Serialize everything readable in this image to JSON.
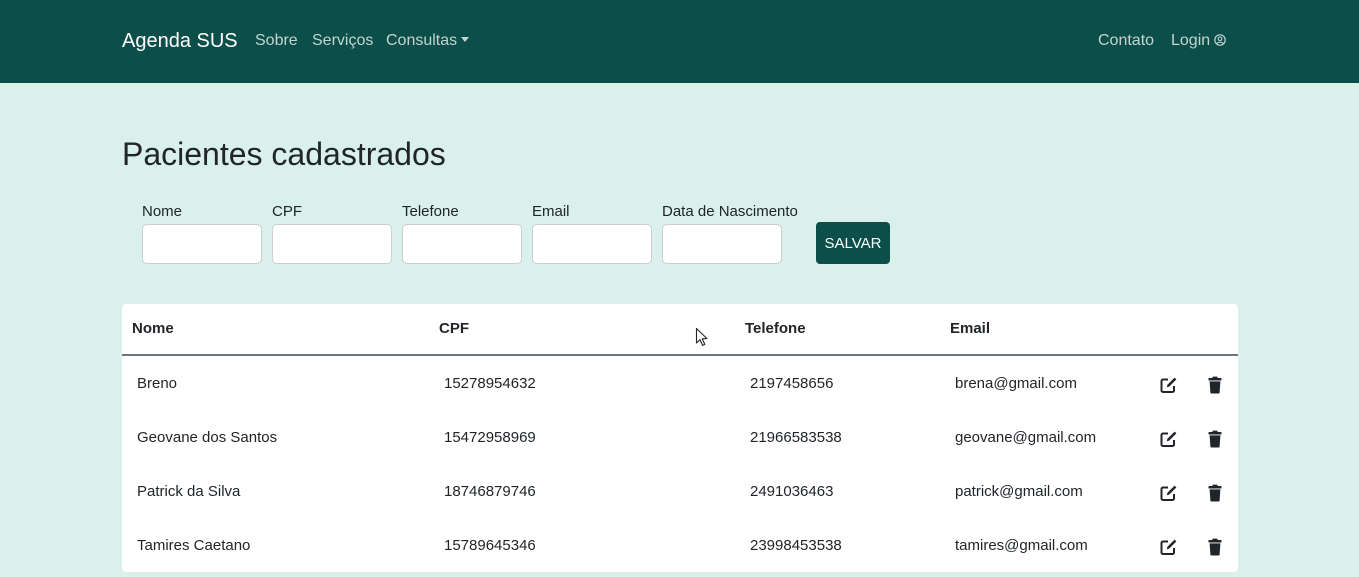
{
  "navbar": {
    "brand": "Agenda SUS",
    "links": [
      "Sobre",
      "Serviços",
      "Consultas"
    ],
    "right_links": [
      "Contato",
      "Login"
    ]
  },
  "page": {
    "title": "Pacientes cadastrados"
  },
  "form": {
    "fields": [
      {
        "label": "Nome",
        "value": ""
      },
      {
        "label": "CPF",
        "value": ""
      },
      {
        "label": "Telefone",
        "value": ""
      },
      {
        "label": "Email",
        "value": ""
      },
      {
        "label": "Data de Nascimento",
        "value": ""
      }
    ],
    "save_label": "SALVAR"
  },
  "table": {
    "headers": [
      "Nome",
      "CPF",
      "Telefone",
      "Email"
    ],
    "rows": [
      {
        "nome": "Breno",
        "cpf": "15278954632",
        "telefone": "2197458656",
        "email": "brena@gmail.com"
      },
      {
        "nome": "Geovane dos Santos",
        "cpf": "15472958969",
        "telefone": "21966583538",
        "email": "geovane@gmail.com"
      },
      {
        "nome": "Patrick da Silva",
        "cpf": "18746879746",
        "telefone": "2491036463",
        "email": "patrick@gmail.com"
      },
      {
        "nome": "Tamires Caetano",
        "cpf": "15789645346",
        "telefone": "23998453538",
        "email": "tamires@gmail.com"
      }
    ],
    "action_icons": [
      "edit-icon",
      "trash-icon"
    ]
  },
  "colors": {
    "navbar": "#0c4f4a",
    "background": "#d9f1ea",
    "accent": "#0c4f4a"
  }
}
